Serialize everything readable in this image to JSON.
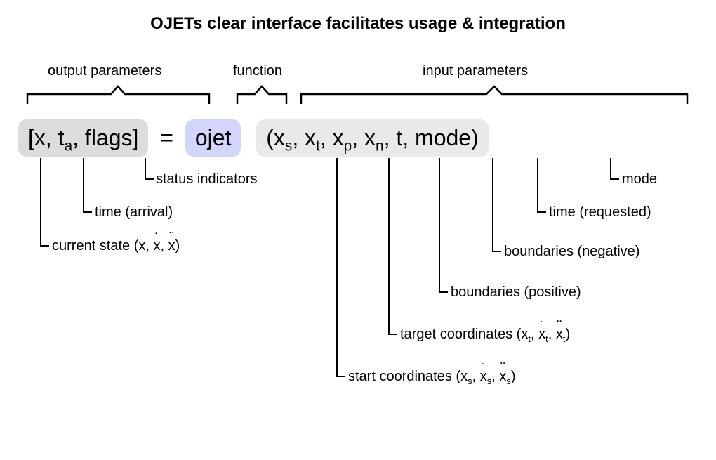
{
  "title": "OJETs clear interface facilitates usage & integration",
  "sections": {
    "output": "output parameters",
    "function": "function",
    "input": "input parameters"
  },
  "formula": {
    "out_prefix": "[x, t",
    "out_sub": "a",
    "out_suffix": ", flags]",
    "equals": "=",
    "fn": "ojet",
    "in_prefix": "(x",
    "in_s": "s",
    "in_sep1": ", x",
    "in_t": "t",
    "in_sep2": ", x",
    "in_p": "p",
    "in_sep3": ", x",
    "in_n": "n",
    "in_suffix": ", t, mode)"
  },
  "annotations": {
    "flags": "status indicators",
    "ta": "time (arrival)",
    "x_pre": "current state (x, ",
    "x_dotx": "x",
    "x_mid": ", ",
    "x_ddotx": "x",
    "x_post": ")",
    "mode": "mode",
    "t": "time (requested)",
    "xn": "boundaries (negative)",
    "xp": "boundaries (positive)",
    "xt_pre": "target coordinates (x",
    "xt_sub": "t",
    "xt_sep": ", ",
    "xt_dotx": "x",
    "xt_ddotx": "x",
    "xt_post": ")",
    "xs_pre": "start coordinates (x",
    "xs_sub": "s",
    "xs_sep": ", ",
    "xs_dotx": "x",
    "xs_ddotx": "x",
    "xs_post": ")"
  }
}
